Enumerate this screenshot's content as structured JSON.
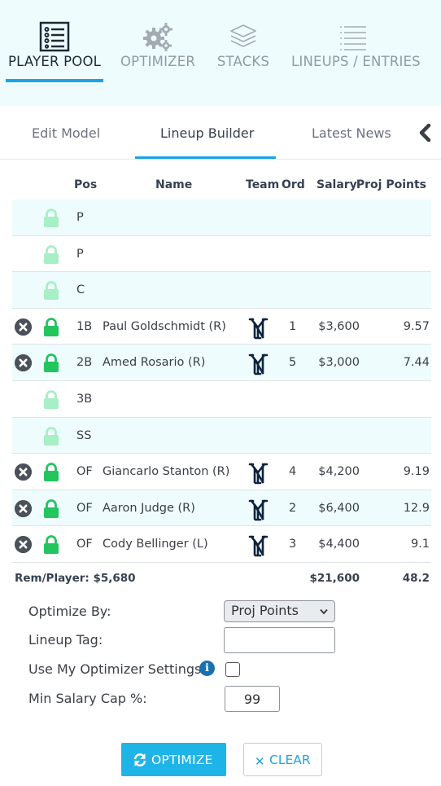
{
  "nav": {
    "items": [
      {
        "label": "PLAYER POOL",
        "icon": "checklist-icon",
        "active": true
      },
      {
        "label": "OPTIMIZER",
        "icon": "gears-icon",
        "active": false
      },
      {
        "label": "STACKS",
        "icon": "layers-icon",
        "active": false
      },
      {
        "label": "LINEUPS / ENTRIES",
        "icon": "list-icon",
        "active": false
      }
    ],
    "accent_color": "#1aa3e8"
  },
  "tabs": [
    {
      "label": "Edit Model",
      "active": false
    },
    {
      "label": "Lineup Builder",
      "active": true
    },
    {
      "label": "Latest News",
      "active": false
    }
  ],
  "table": {
    "headers": {
      "pos": "Pos",
      "name": "Name",
      "team": "Team",
      "ord": "Ord",
      "salary": "Salary",
      "proj": "Proj Points"
    },
    "rows": [
      {
        "pos": "P",
        "name": "",
        "ord": "",
        "salary": "",
        "proj": "",
        "filled": false
      },
      {
        "pos": "P",
        "name": "",
        "ord": "",
        "salary": "",
        "proj": "",
        "filled": false
      },
      {
        "pos": "C",
        "name": "",
        "ord": "",
        "salary": "",
        "proj": "",
        "filled": false
      },
      {
        "pos": "1B",
        "name": "Paul Goldschmidt (R)",
        "team_icon": "yankees-logo-icon",
        "ord": "1",
        "salary": "$3,600",
        "proj": "9.57",
        "filled": true
      },
      {
        "pos": "2B",
        "name": "Amed Rosario (R)",
        "team_icon": "yankees-logo-icon",
        "ord": "5",
        "salary": "$3,000",
        "proj": "7.44",
        "filled": true
      },
      {
        "pos": "3B",
        "name": "",
        "ord": "",
        "salary": "",
        "proj": "",
        "filled": false
      },
      {
        "pos": "SS",
        "name": "",
        "ord": "",
        "salary": "",
        "proj": "",
        "filled": false
      },
      {
        "pos": "OF",
        "name": "Giancarlo Stanton (R)",
        "team_icon": "yankees-logo-icon",
        "ord": "4",
        "salary": "$4,200",
        "proj": "9.19",
        "filled": true
      },
      {
        "pos": "OF",
        "name": "Aaron Judge (R)",
        "team_icon": "yankees-logo-icon",
        "ord": "2",
        "salary": "$6,400",
        "proj": "12.9",
        "filled": true
      },
      {
        "pos": "OF",
        "name": "Cody Bellinger (L)",
        "team_icon": "yankees-logo-icon",
        "ord": "3",
        "salary": "$4,400",
        "proj": "9.1",
        "filled": true
      }
    ],
    "totals": {
      "rem_per_player": "Rem/Player: $5,680",
      "salary": "$21,600",
      "proj": "48.2"
    }
  },
  "form": {
    "optimize_by_label": "Optimize By:",
    "optimize_by_value": "Proj Points",
    "lineup_tag_label": "Lineup Tag:",
    "lineup_tag_value": "",
    "use_settings_label": "Use My Optimizer Settings",
    "use_settings_checked": false,
    "min_salary_label": "Min Salary Cap %:",
    "min_salary_value": "99"
  },
  "buttons": {
    "optimize": "OPTIMIZE",
    "clear": "CLEAR"
  },
  "colors": {
    "lock_active": "#22c55e",
    "lock_inactive": "#a7efc5",
    "row_alt": "#effcfd",
    "team": "#0c2340"
  }
}
